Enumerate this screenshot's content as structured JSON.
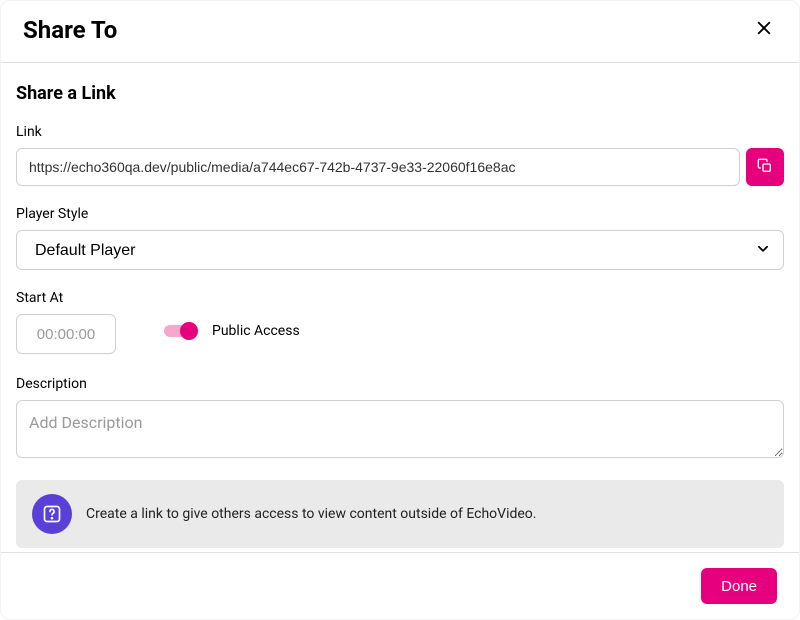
{
  "modal": {
    "title": "Share To"
  },
  "section": {
    "heading": "Share a Link"
  },
  "link": {
    "label": "Link",
    "value": "https://echo360qa.dev/public/media/a744ec67-742b-4737-9e33-22060f16e8ac"
  },
  "playerStyle": {
    "label": "Player Style",
    "selected": "Default Player"
  },
  "startAt": {
    "label": "Start At",
    "placeholder": "00:00:00",
    "value": ""
  },
  "publicAccess": {
    "label": "Public Access",
    "enabled": true
  },
  "description": {
    "label": "Description",
    "placeholder": "Add Description",
    "value": ""
  },
  "info": {
    "text": "Create a link to give others access to view content outside of EchoVideo."
  },
  "footer": {
    "done": "Done"
  }
}
